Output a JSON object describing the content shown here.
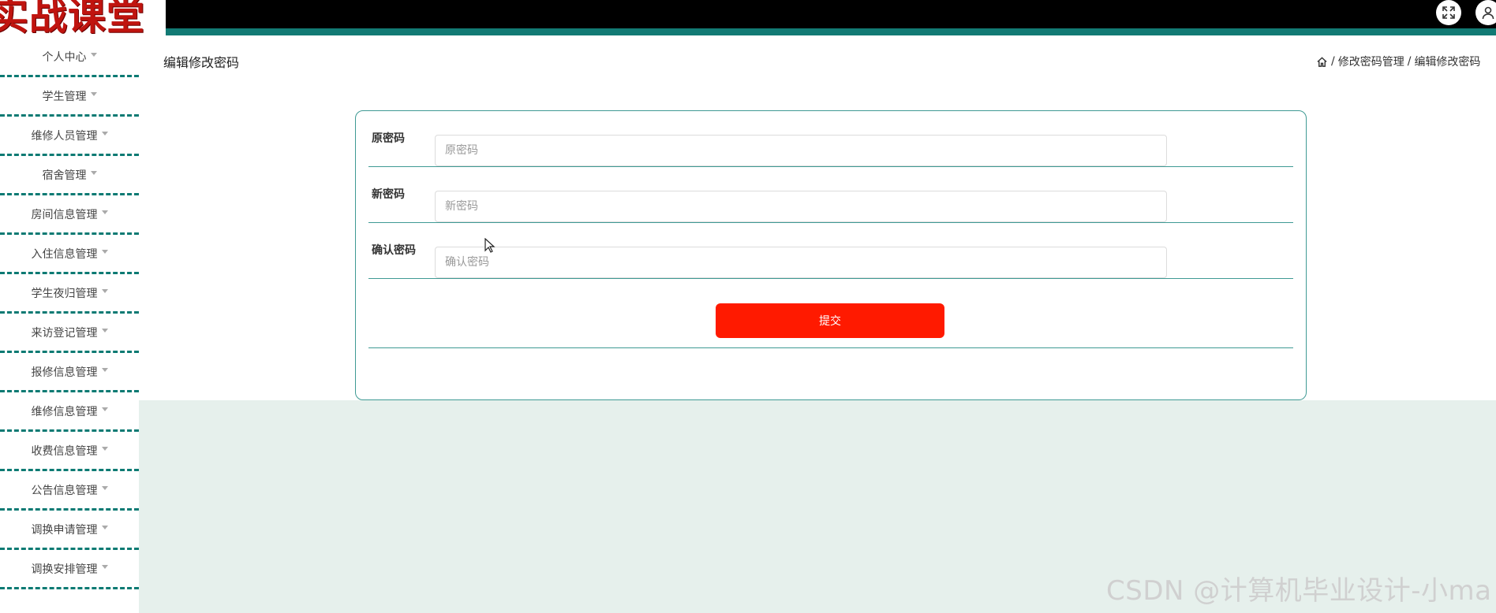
{
  "app": {
    "logo_text": "实战课堂"
  },
  "sidebar": {
    "items": [
      {
        "label": "个人中心"
      },
      {
        "label": "学生管理"
      },
      {
        "label": "维修人员管理"
      },
      {
        "label": "宿舍管理"
      },
      {
        "label": "房间信息管理"
      },
      {
        "label": "入住信息管理"
      },
      {
        "label": "学生夜归管理"
      },
      {
        "label": "来访登记管理"
      },
      {
        "label": "报修信息管理"
      },
      {
        "label": "维修信息管理"
      },
      {
        "label": "收费信息管理"
      },
      {
        "label": "公告信息管理"
      },
      {
        "label": "调换申请管理"
      },
      {
        "label": "调换安排管理"
      }
    ]
  },
  "header": {
    "page_title": "编辑修改密码",
    "breadcrumb": {
      "sep": "/",
      "level1": "修改密码管理",
      "level2": "编辑修改密码"
    },
    "icons": {
      "fullscreen": "fullscreen-icon",
      "user": "user-icon"
    }
  },
  "form": {
    "old_password": {
      "label": "原密码",
      "placeholder": "原密码",
      "value": ""
    },
    "new_password": {
      "label": "新密码",
      "placeholder": "新密码",
      "value": ""
    },
    "confirm_password": {
      "label": "确认密码",
      "placeholder": "确认密码",
      "value": ""
    },
    "submit_label": "提交"
  },
  "watermark": "CSDN @计算机毕业设计-小ma",
  "colors": {
    "accent": "#127a74",
    "submit": "#ff1a00",
    "topbar": "#000000",
    "panel_bg": "#e6f0ec"
  }
}
